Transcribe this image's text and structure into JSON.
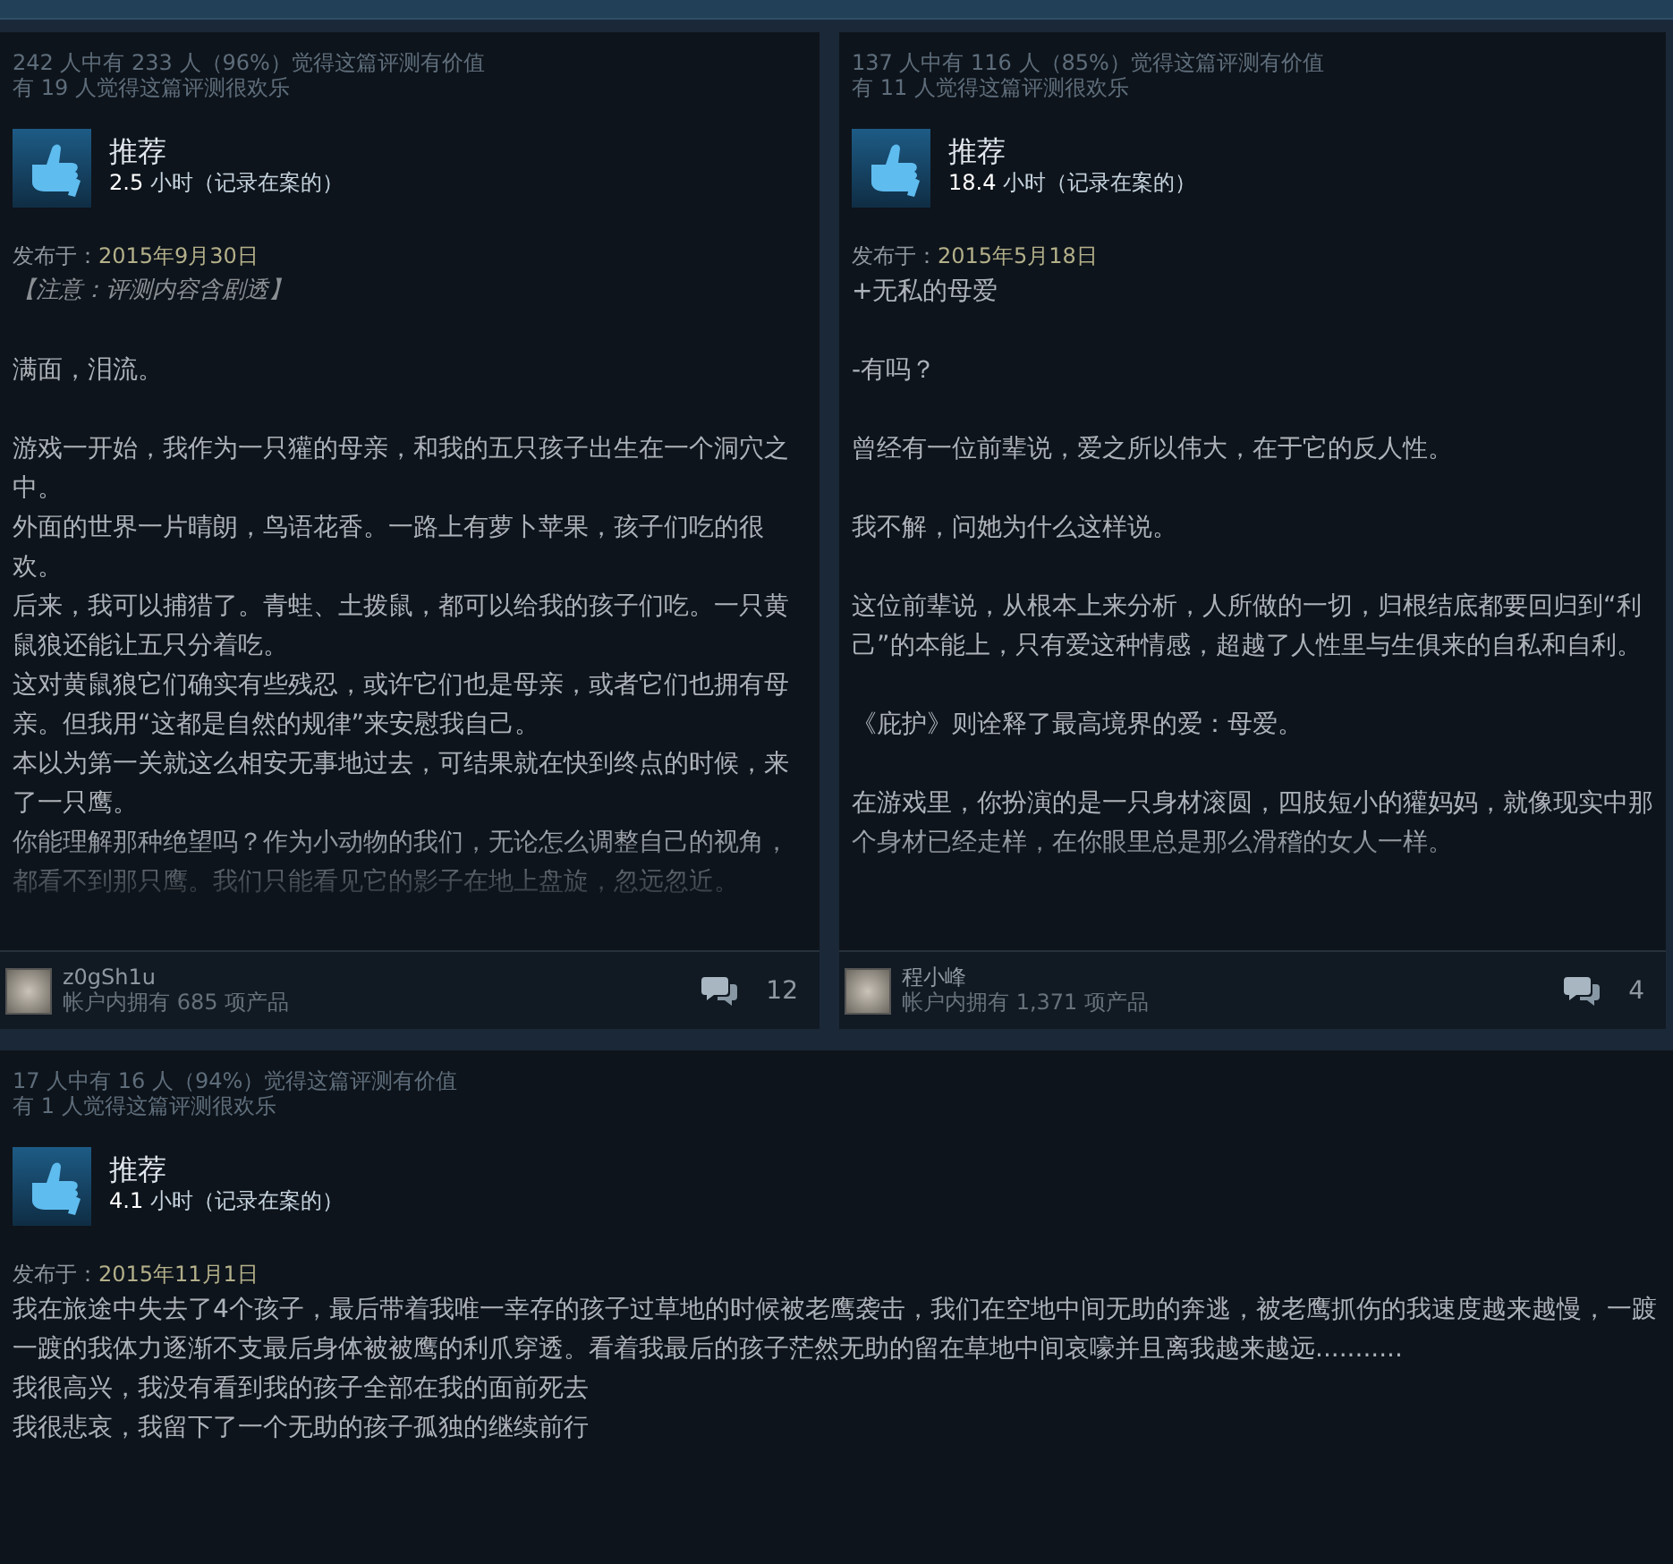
{
  "reviews": [
    {
      "helpful": "242 人中有 233 人（96%）觉得这篇评测有价值",
      "funny": "有 19 人觉得这篇评测很欢乐",
      "verdict": "推荐",
      "hours": "2.5",
      "hours_suffix": "小时（记录在案的）",
      "posted_label": "发布于：",
      "posted_date": "2015年9月30日",
      "paragraphs": [
        {
          "lines": [
            {
              "kind": "note",
              "text": "【注意：评测内容含剧透】"
            }
          ]
        },
        {
          "lines": [
            {
              "kind": "text",
              "text": "满面，泪流。"
            }
          ]
        },
        {
          "lines": [
            {
              "kind": "text",
              "text": "游戏一开始，我作为一只獾的母亲，和我的五只孩子出生在一个洞穴之中。"
            },
            {
              "kind": "text",
              "text": "外面的世界一片晴朗，鸟语花香。一路上有萝卜苹果，孩子们吃的很欢。"
            },
            {
              "kind": "text",
              "text": "后来，我可以捕猎了。青蛙、土拨鼠，都可以给我的孩子们吃。一只黄鼠狼还能让五只分着吃。"
            },
            {
              "kind": "text",
              "text": "这对黄鼠狼它们确实有些残忍，或许它们也是母亲，或者它们也拥有母亲。但我用“这都是自然的规律”来安慰我自己。"
            },
            {
              "kind": "text",
              "text": "本以为第一关就这么相安无事地过去，可结果就在快到终点的时候，来了一只鹰。"
            },
            {
              "kind": "text",
              "text": "你能理解那种绝望吗？作为小动物的我们，无论怎么调整自己的视角，都看不到那只鹰。我们只能看见它的影子在地上盘旋，忽远忽近。"
            }
          ]
        }
      ],
      "author": "z0gSh1u",
      "products": "帐户内拥有 685 项产品",
      "comments": "12"
    },
    {
      "helpful": "137 人中有 116 人（85%）觉得这篇评测有价值",
      "funny": "有 11 人觉得这篇评测很欢乐",
      "verdict": "推荐",
      "hours": "18.4",
      "hours_suffix": "小时（记录在案的）",
      "posted_label": "发布于：",
      "posted_date": "2015年5月18日",
      "paragraphs": [
        {
          "lines": [
            {
              "kind": "text",
              "text": "+无私的母爱"
            }
          ]
        },
        {
          "lines": [
            {
              "kind": "text",
              "text": "-有吗？"
            }
          ]
        },
        {
          "lines": [
            {
              "kind": "text",
              "text": "曾经有一位前辈说，爱之所以伟大，在于它的反人性。"
            }
          ]
        },
        {
          "lines": [
            {
              "kind": "text",
              "text": "我不解，问她为什么这样说。"
            }
          ]
        },
        {
          "lines": [
            {
              "kind": "text",
              "text": "这位前辈说，从根本上来分析，人所做的一切，归根结底都要回归到“利己”的本能上，只有爱这种情感，超越了人性里与生俱来的自私和自利。"
            }
          ]
        },
        {
          "lines": [
            {
              "kind": "text",
              "text": "《庇护》则诠释了最高境界的爱：母爱。"
            }
          ]
        },
        {
          "lines": [
            {
              "kind": "text",
              "text": "在游戏里，你扮演的是一只身材滚圆，四肢短小的獾妈妈，就像现实中那个身材已经走样，在你眼里总是那么滑稽的女人一样。"
            }
          ]
        }
      ],
      "author": "程小峰",
      "products": "帐户内拥有 1,371 项产品",
      "comments": "4"
    },
    {
      "helpful": "17 人中有 16 人（94%）觉得这篇评测有价值",
      "funny": "有 1 人觉得这篇评测很欢乐",
      "verdict": "推荐",
      "hours": "4.1",
      "hours_suffix": "小时（记录在案的）",
      "posted_label": "发布于：",
      "posted_date": "2015年11月1日",
      "paragraphs": [
        {
          "lines": [
            {
              "kind": "text",
              "text": "我在旅途中失去了4个孩子，最后带着我唯一幸存的孩子过草地的时候被老鹰袭击，我们在空地中间无助的奔逃，被老鹰抓伤的我速度越来越慢，一踱一踱的我体力逐渐不支最后身体被被鹰的利爪穿透。看着我最后的孩子茫然无助的留在草地中间哀嚎并且离我越来越远..........."
            },
            {
              "kind": "text",
              "text": "我很高兴，我没有看到我的孩子全部在我的面前死去"
            },
            {
              "kind": "text",
              "text": "我很悲哀，我留下了一个无助的孩子孤独的继续前行"
            }
          ]
        }
      ]
    }
  ]
}
